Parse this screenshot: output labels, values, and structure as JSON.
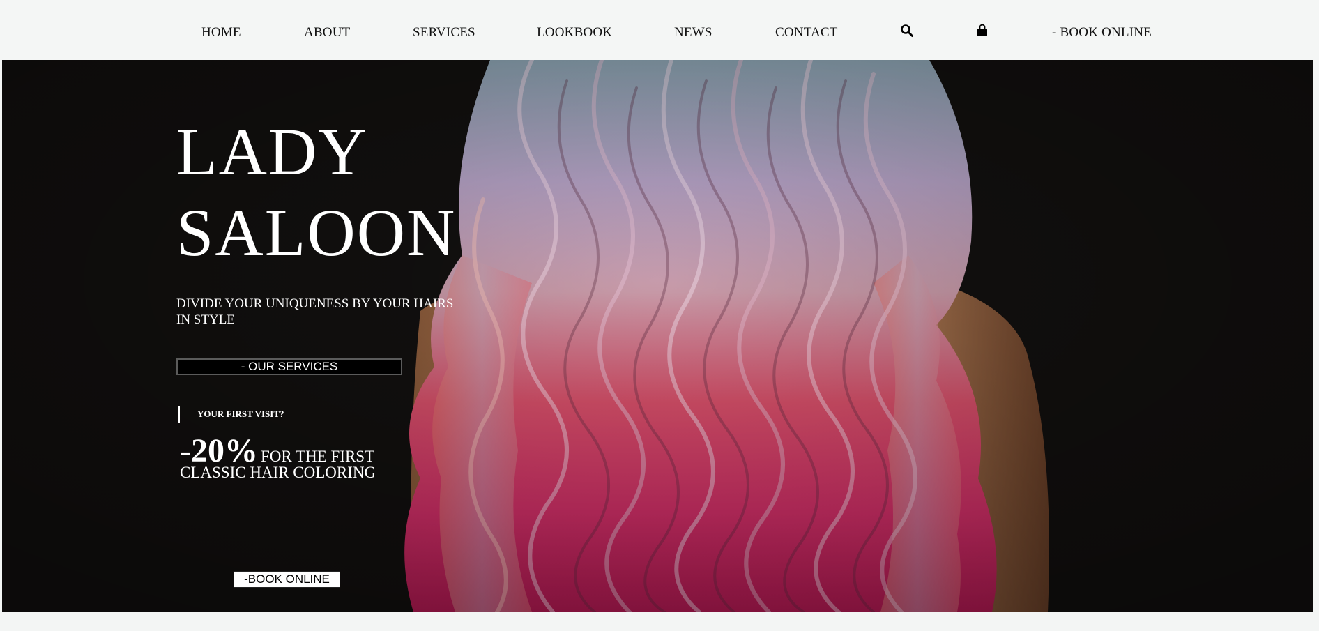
{
  "nav": {
    "items": [
      "HOME",
      "ABOUT",
      "SERVICES",
      "LOOKBOOK",
      "NEWS",
      "CONTACT"
    ],
    "search_icon": "search-icon",
    "cart_icon": "shopping-bag-icon",
    "book_label": "- BOOK ONLINE"
  },
  "hero": {
    "title_line1": "LADY",
    "title_line2": "SALOON",
    "tagline": "DIVIDE YOUR UNIQUENESS BY YOUR HAIRS IN STYLE",
    "services_button": "- OUR SERVICES",
    "visit_label": "YOUR FIRST VISIT?",
    "discount": "-20%",
    "discount_text_1": "FOR THE FIRST",
    "discount_text_2": "CLASSIC HAIR COLORING",
    "book_button": "-BOOK ONLINE"
  },
  "colors": {
    "nav_bg": "#f4f6f5",
    "hero_bg": "#12100f",
    "text_light": "#ffffff",
    "hair_pink": "#e0407a",
    "hair_lavender": "#b8a4c8",
    "hair_blue": "#8aa8b8"
  }
}
